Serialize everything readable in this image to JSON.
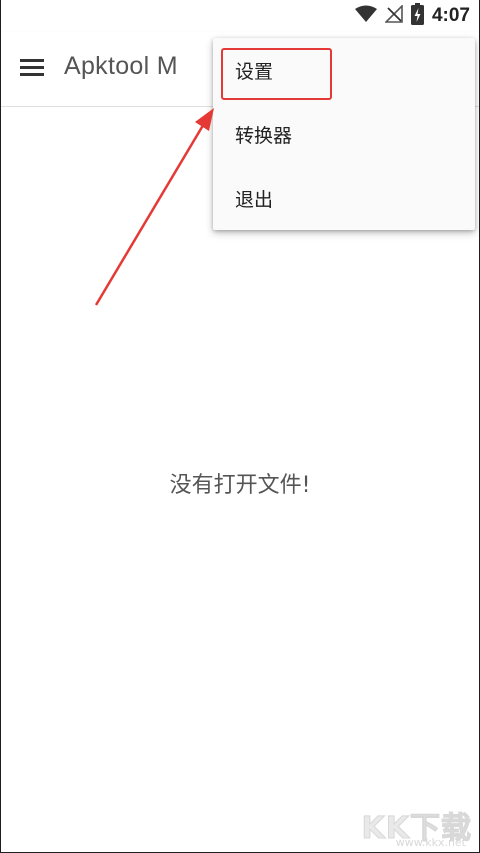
{
  "status_bar": {
    "time": "4:07",
    "icons": [
      "wifi-icon",
      "no-signal-icon",
      "battery-charging-icon"
    ]
  },
  "app_bar": {
    "title": "Apktool M",
    "menu_icon": "hamburger-menu-icon"
  },
  "main": {
    "empty_message": "没有打开文件!"
  },
  "popup_menu": {
    "items": [
      {
        "label": "设置"
      },
      {
        "label": "转换器"
      },
      {
        "label": "退出"
      }
    ]
  },
  "annotation": {
    "highlight_color": "#e53935",
    "arrow_color": "#e53935"
  },
  "watermark": {
    "logo_text": "KK下载",
    "url": "www.kkx.net"
  }
}
